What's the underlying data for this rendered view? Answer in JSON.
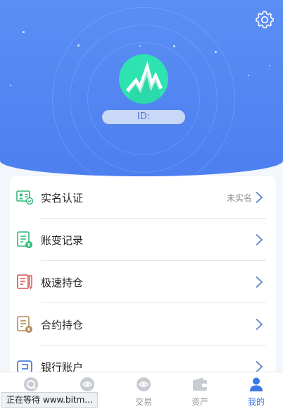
{
  "profile": {
    "id_label": "ID:"
  },
  "menu": {
    "items": [
      {
        "label": "实名认证",
        "status": "未实名",
        "icon": "id-card-icon"
      },
      {
        "label": "账变记录",
        "status": "",
        "icon": "ledger-icon"
      },
      {
        "label": "极速持仓",
        "status": "",
        "icon": "fast-position-icon"
      },
      {
        "label": "合约持仓",
        "status": "",
        "icon": "contract-position-icon"
      },
      {
        "label": "银行账户",
        "status": "",
        "icon": "bank-account-icon"
      }
    ]
  },
  "tabbar": {
    "tabs": [
      {
        "label": "",
        "icon": "home-icon"
      },
      {
        "label": "",
        "icon": "market-icon"
      },
      {
        "label": "交易",
        "icon": "trade-icon"
      },
      {
        "label": "资产",
        "icon": "wallet-icon"
      },
      {
        "label": "我的",
        "icon": "user-icon",
        "active": true
      }
    ]
  },
  "browser_status": {
    "text": "正在等待 www.bitm..."
  },
  "colors": {
    "header_blue": "#4d7ff0",
    "avatar_green": "#2fe3b1",
    "active_tab": "#3c78e8",
    "chevron_blue": "#5b82c8"
  }
}
